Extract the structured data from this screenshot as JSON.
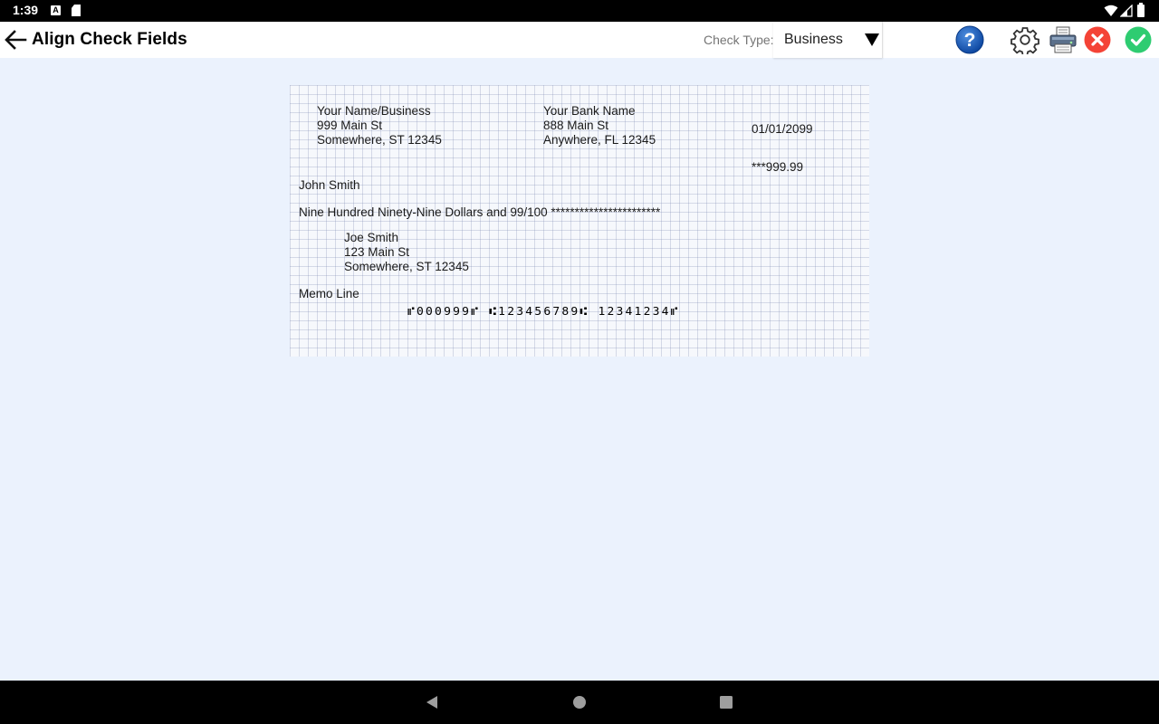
{
  "status_bar": {
    "time": "1:39",
    "notification_icons": [
      "a-letter-icon",
      "sd-card-icon"
    ],
    "notification_a": "A",
    "right_icons": [
      "wifi-icon",
      "signal-icon",
      "battery-icon"
    ]
  },
  "app_bar": {
    "title": "Align Check Fields",
    "check_type_label": "Check Type:",
    "check_type_value": "Business",
    "actions": [
      "help-icon",
      "settings-icon",
      "printer-icon",
      "cancel-icon",
      "confirm-icon"
    ]
  },
  "check": {
    "payer": {
      "name": "Your Name/Business",
      "address_line1": "999 Main St",
      "address_line2": "Somewhere, ST 12345"
    },
    "bank": {
      "name": "Your Bank Name",
      "address_line1": "888 Main St",
      "address_line2": "Anywhere, FL 12345"
    },
    "date": "01/01/2099",
    "amount": "***999.99",
    "payee": "John Smith",
    "amount_words": "Nine Hundred Ninety-Nine Dollars and 99/100 ***********************",
    "payee_address": {
      "name": "Joe Smith",
      "line1": "123 Main St",
      "line2": "Somewhere, ST 12345"
    },
    "memo": "Memo Line",
    "micr": "⑈000999⑈ ⑆123456789⑆ 12341234⑈"
  },
  "colors": {
    "background": "#ebf2fd",
    "help": "#1565c0",
    "cancel": "#f44336",
    "confirm": "#2ecc71"
  }
}
